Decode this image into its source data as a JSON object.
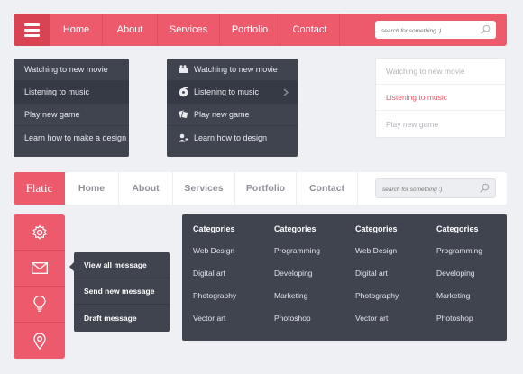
{
  "nav_primary": {
    "menu_icon": "hamburger-icon",
    "items": [
      "Home",
      "About",
      "Services",
      "Portfolio",
      "Contact"
    ],
    "search_placeholder": "search for something :)",
    "search_icon": "search-icon"
  },
  "dropdown_plain": {
    "items": [
      "Watching to new movie",
      "Listening to music",
      "Play new game",
      "Learn how to make a design"
    ],
    "highlighted_index": 1
  },
  "dropdown_icons": {
    "items": [
      {
        "label": "Watching to new movie",
        "icon": "film-icon"
      },
      {
        "label": "Listening to music",
        "icon": "music-icon"
      },
      {
        "label": "Play new game",
        "icon": "game-icon"
      },
      {
        "label": "Learn how to design",
        "icon": "user-icon"
      }
    ],
    "highlighted_index": 1,
    "submenu_icon": "chevron-right-icon"
  },
  "dropdown_light": {
    "items": [
      "Watching to new movie",
      "Listening to music",
      "Play new game"
    ],
    "active_index": 1
  },
  "nav_secondary": {
    "brand": "Flatic",
    "items": [
      "Home",
      "About",
      "Services",
      "Portfolio",
      "Contact"
    ],
    "search_placeholder": "search for something :)",
    "search_icon": "search-icon"
  },
  "icon_bar": {
    "icons": [
      "gear-icon",
      "mail-icon",
      "lightbulb-icon",
      "location-pin-icon"
    ]
  },
  "message_menu": {
    "items": [
      "View all message",
      "Send new message",
      "Draft message"
    ]
  },
  "mega_menu": {
    "columns": [
      {
        "heading": "Categories",
        "links": [
          "Web Design",
          "Digital art",
          "Photography",
          "Vector art"
        ]
      },
      {
        "heading": "Categories",
        "links": [
          "Programming",
          "Developing",
          "Marketing",
          "Photoshop"
        ]
      },
      {
        "heading": "Categories",
        "links": [
          "Web Design",
          "Digital art",
          "Photography",
          "Vector art"
        ]
      },
      {
        "heading": "Categories",
        "links": [
          "Programming",
          "Developing",
          "Marketing",
          "Photoshop"
        ]
      }
    ]
  },
  "colors": {
    "accent": "#ec5a6b",
    "accent_dark": "#d94455",
    "dark_panel": "#3f444f",
    "background": "#eef0f4"
  }
}
